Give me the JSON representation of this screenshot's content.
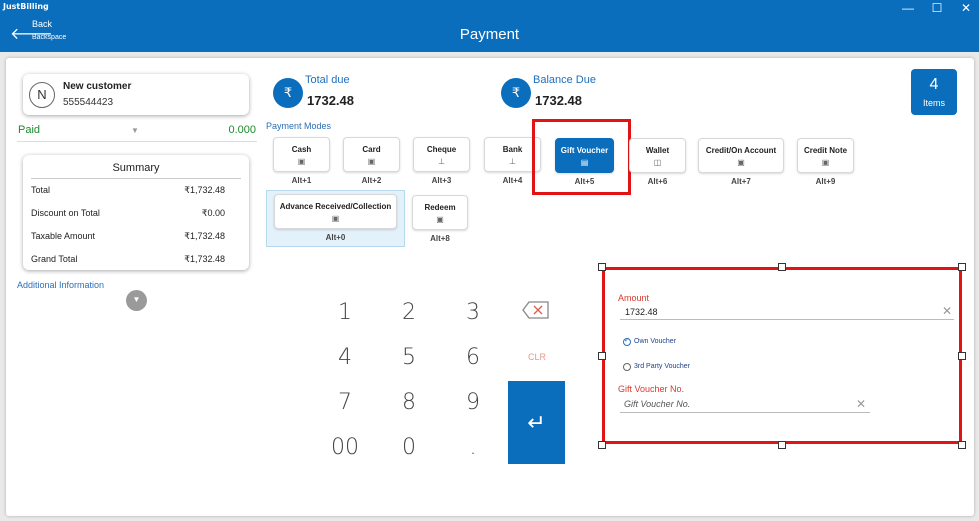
{
  "app": {
    "logo": "JustBilling",
    "minimize": "—",
    "maximize": "☐",
    "close": "✕"
  },
  "header": {
    "back_label": "Back",
    "back_sub": "Backspace",
    "title": "Payment"
  },
  "customer": {
    "avatar": "N",
    "name": "New customer",
    "phone": "555544423"
  },
  "paid": {
    "label": "Paid",
    "value": "0.000"
  },
  "summary": {
    "title": "Summary",
    "rows": [
      {
        "label": "Total",
        "value": "₹1,732.48"
      },
      {
        "label": "Discount on Total",
        "value": "₹0.00"
      },
      {
        "label": "Taxable Amount",
        "value": "₹1,732.48"
      },
      {
        "label": "Grand Total",
        "value": "₹1,732.48"
      }
    ]
  },
  "additional_info": "Additional Information",
  "total_due": {
    "label": "Total due",
    "value": "1732.48",
    "symbol": "₹"
  },
  "balance_due": {
    "label": "Balance Due",
    "value": "1732.48",
    "symbol": "₹"
  },
  "items": {
    "count": "4",
    "label": "Items"
  },
  "payment_modes": {
    "label": "Payment Modes",
    "modes": [
      {
        "title": "Cash",
        "shortcut": "Alt+1"
      },
      {
        "title": "Card",
        "shortcut": "Alt+2"
      },
      {
        "title": "Cheque",
        "shortcut": "Alt+3"
      },
      {
        "title": "Bank",
        "shortcut": "Alt+4"
      },
      {
        "title": "Gift Voucher",
        "shortcut": "Alt+5"
      },
      {
        "title": "Wallet",
        "shortcut": "Alt+6"
      },
      {
        "title": "Credit/On Account",
        "shortcut": "Alt+7"
      },
      {
        "title": "Credit Note",
        "shortcut": "Alt+9"
      },
      {
        "title": "Advance Received/Collection",
        "shortcut": "Alt+0"
      },
      {
        "title": "Redeem",
        "shortcut": "Alt+8"
      }
    ],
    "active": "Gift Voucher"
  },
  "keypad": {
    "keys": [
      "1",
      "2",
      "3",
      "4",
      "5",
      "6",
      "7",
      "8",
      "9",
      "00",
      "0",
      "."
    ],
    "clear": "CLR",
    "enter": "↵"
  },
  "gift_voucher_form": {
    "amount_label": "Amount",
    "amount_value": "1732.48",
    "own_voucher": "Own Voucher",
    "third_party": "3rd Party Voucher",
    "selected_type": "Own Voucher",
    "voucher_no_label": "Gift Voucher No.",
    "voucher_no_placeholder": "Gift Voucher No."
  },
  "colors": {
    "accent": "#0a6ebd",
    "paid_green": "#1b8a2a",
    "highlight_red": "#e01414",
    "field_label": "#d9382c"
  }
}
